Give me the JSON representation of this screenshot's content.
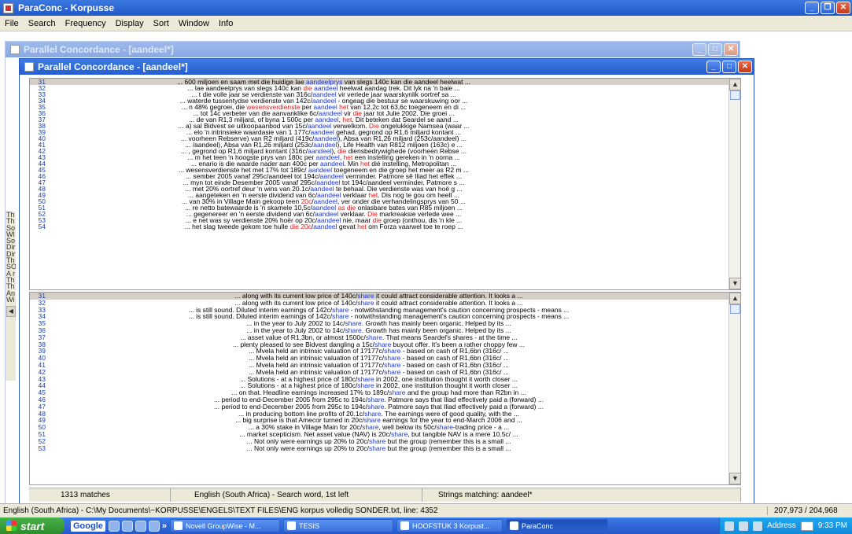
{
  "app": {
    "title": "ParaConc - Korpusse",
    "menu": [
      "File",
      "Search",
      "Frequency",
      "Display",
      "Sort",
      "Window",
      "Info"
    ]
  },
  "outer_window": {
    "title": "Parallel Concordance - [aandeel*]"
  },
  "left_strip_text": "Th\nTh\nSo\nWl\nSo\nDir\nDir\nTh\nSO\nA r\nTh\nTh\nAn\nWi",
  "inner_window": {
    "title": "Parallel Concordance - [aandeel*]"
  },
  "top_pane": {
    "rows": [
      {
        "n": "31",
        "t": "... 600 miljoen en saam met die huidige lae <b>aandeelprys</b> van slegs 140c kan die aandeel heelwat ..."
      },
      {
        "n": "32",
        "t": "... lae aandeelprys van slegs 140c kan <r>die</r> <b>aandeel</b> heelwat aandag trek. Dit lyk na 'n baie ..."
      },
      {
        "n": "33",
        "t": "... t die volle jaar se verdienste van 316c/<b>aandeel</b> vir verlede jaar waarskynlik oortref sa ..."
      },
      {
        "n": "34",
        "t": "... waterde tussentydse verdienste van 142c/<b>aandeel</b> - ongeag die bestuur se waarskuwing oor ..."
      },
      {
        "n": "35",
        "t": "... n 48% gegroei, die <r>wesensverdienste</r> per <b>aandeel</b> <r>het</r> van 12,2c tot 63,6c toegeneem en di ..."
      },
      {
        "n": "36",
        "t": "... tot 14c verbeter van die aanvanklike 6c/<b>aandeel</b> vir <r>die</r> jaar tot Julie 2002. Die groei ..."
      },
      {
        "n": "37",
        "t": "... de van R1,3 miljard, of byna 1 500c per <b>aandeel</b>, <r>het</r>. Dit beteken dat Seardel se aand ..."
      },
      {
        "n": "38",
        "t": "... a) sal Bidvest se uitkoopaanbod van 15c/<b>aandeel</b> verwelkom. <r>Die</r> ongelukkige Namsea (waar ..."
      },
      {
        "n": "39",
        "t": "... elo 'n intrinsieke waardasie van 1 177c/<b>aandeel</b> gehad, gegrond op R1,6 miljard kontant ..."
      },
      {
        "n": "40",
        "t": "... voorheen Rebserve) van R2 miljard (419c/<b>aandeel</b>), Absa van R1,26 miljard (253c/aandeel) ..."
      },
      {
        "n": "41",
        "t": "... /aandeel), Absa van R1,26 miljard (253c/<b>aandeel</b>), Life Health van R812 miljoen (163c) e ..."
      },
      {
        "n": "42",
        "t": "... , gegrond op R1,6 miljard kontant (316c/<b>aandeel</b>), <r>die</r> diensbedrywighede (voorheen Rebse ..."
      },
      {
        "n": "43",
        "t": "... m het teen 'n hoogste prys van 180c per <b>aandeel</b>, <r>het</r> een instelling gereken in 'n oorna ..."
      },
      {
        "n": "44",
        "t": "... enario is die waarde nader aan 400c per <b>aandeel</b>. Min <r>het</r> dié instelling, Metropolitan ..."
      },
      {
        "n": "45",
        "t": "... wesensverdienste het met 17% tot 189c/ <b>aandeel</b> toegeneem en die groep het meer as R2 m ..."
      },
      {
        "n": "46",
        "t": "... sember 2005 vanaf 295c/aandeel tot 194c/<b>aandeel</b> verminder. Patmore sê Iliad het effek ..."
      },
      {
        "n": "47",
        "t": "... myn tot einde Desember 2005 vanaf 295c/<b>aandeel</b> tot 194c/aandeel verminder. Patmore s ..."
      },
      {
        "n": "48",
        "t": "... met 20% oortref deur 'n wins van 20.1c/<b>aandeel</b> te behaal. Die verdienste was van hoë g ..."
      },
      {
        "n": "49",
        "t": "... aangeteken en 'n eerste dividend van 6c/<b>aandeel</b> verklaar <r>het</r>. Dis nog te gou om heelt ..."
      },
      {
        "n": "50",
        "t": "... van 30% in Village Main gekoop teen <r>20c</r>/<b>aandeel</b>, ver onder die verhandelingsprys van 50 ..."
      },
      {
        "n": "51",
        "t": "... re netto batewaarde is 'n skamele 10,5c/<b>aandeel</b> <r>as die</r> onlasbare bates van R85 miljoen ..."
      },
      {
        "n": "52",
        "t": "... gegenereer en 'n eerste dividend van 6c/<b>aandeel</b> verklaar. <r>Die</r> markreaksie verlede wee ..."
      },
      {
        "n": "53",
        "t": "... e net was sy verdienste 20% hoër op 20c/<b>aandeel</b> nie, maar <r>die</r> groep (onthou, dis 'n kle ..."
      },
      {
        "n": "54",
        "t": "... het slag tweede gekom toe hulle <r>die</r> <r>20c</r>/<b>aandeel</b> gevat <r>het</r> om Forza vaarwel toe te roep ..."
      }
    ]
  },
  "bottom_pane": {
    "rows": [
      {
        "n": "31",
        "t": "... along with its current low price of 140c/<b>share</b> it could attract considerable attention. It looks a ..."
      },
      {
        "n": "32",
        "t": "... along with its current low price of 140c/<b>share</b> it could attract considerable attention. It looks a ..."
      },
      {
        "n": "33",
        "t": "... is still sound. Diluted interim earnings of 142c/<b>share</b> - notwithstanding management's caution concerning prospects - means ..."
      },
      {
        "n": "34",
        "t": "... is still sound. Diluted interim earnings of 142c/<b>share</b> - notwithstanding management's caution concerning prospects - means ..."
      },
      {
        "n": "35",
        "t": "... in the year to July 2002 to 14c/<b>share</b>. Growth has mainly been organic. Helped by its ..."
      },
      {
        "n": "36",
        "t": "... in the year to July 2002 to 14c/<b>share</b>. Growth has mainly been organic. Helped by its ..."
      },
      {
        "n": "37",
        "t": "... asset value of R1,3bn, or almost 1500c/<b>share</b>. That means Seardel's shares - at the time ..."
      },
      {
        "n": "38",
        "t": "... plenty pleased to see Bidvest dangling a 15c/<b>share</b> buyout offer. It's been a rather choppy few ..."
      },
      {
        "n": "39",
        "t": "... Mvela held an intrinsic valuation of 1?177c/<b>share</b> - based on cash of R1,6bn (316c/ ..."
      },
      {
        "n": "40",
        "t": "... Mvela held an intrinsic valuation of 1?177c/<b>share</b> - based on cash of R1,6bn (316c/ ..."
      },
      {
        "n": "41",
        "t": "... Mvela held an intrinsic valuation of 1?177c/<b>share</b> - based on cash of R1,6bn (316c/ ..."
      },
      {
        "n": "42",
        "t": "... Mvela held an intrinsic valuation of 1?177c/<b>share</b> - based on cash of R1,6bn (316c/ ..."
      },
      {
        "n": "43",
        "t": "... Solutions - at a highest price of 180c/<b>share</b> in 2002, one institution thought it worth closer ..."
      },
      {
        "n": "44",
        "t": "... Solutions - at a highest price of 180c/<b>share</b> in 2002, one institution thought it worth closer ..."
      },
      {
        "n": "45",
        "t": "... on that. Headline earnings increased 17% to 189c/<b>share</b> and the group had more than R2bn in ..."
      },
      {
        "n": "46",
        "t": "... period to end-December 2005 from 295c to 194c/<b>share</b>. Patmore says that Iliad effectively paid a (forward) ..."
      },
      {
        "n": "47",
        "t": "... period to end-December 2005 from 295c to 194c/<b>share</b>. Patmore says that Iliad effectively paid a (forward) ..."
      },
      {
        "n": "48",
        "t": "... in producing bottom line profits of 20.1c/<b>share</b>. The earnings were of good quality, with the ..."
      },
      {
        "n": "49",
        "t": "... big surprise is that Amecor turned in 20c/<b>share</b> earnings for the year to end-March 2006 and ..."
      },
      {
        "n": "50",
        "t": "... a 30% stake in Village Main for 20c/<b>share</b>, well below its 50c/<b>share</b>-trading price - a ..."
      },
      {
        "n": "51",
        "t": "... market scepticism. Net asset value (NAV) is 20c/<b>share</b>, but tangible NAV is a mere 10.5c/ ..."
      },
      {
        "n": "52",
        "t": "... Not only were earnings up 20% to 20c/<b>share</b> but the group (remember this is a small ..."
      },
      {
        "n": "53",
        "t": "... Not only were earnings up 20% to 20c/<b>share</b> but the group (remember this is a small ..."
      }
    ]
  },
  "statusbar": {
    "matches": "1313 matches",
    "language": "English (South Africa) - Search word, 1st left",
    "strings": "Strings matching: aandeel*"
  },
  "app_status": {
    "message": "English (South Africa) - C:\\My Documents\\~KORPUSSE\\ENGELS\\TEXT FILES\\ENG korpus volledig SONDER.txt, line: 4352",
    "position": "207,973 / 204,968"
  },
  "taskbar": {
    "start": "start",
    "google": "Google",
    "more": "»",
    "tasks": [
      "Novell GroupWise - M...",
      "TESIS",
      "HOOFSTUK 3 Korpust...",
      "ParaConc"
    ],
    "address_label": "Address",
    "clock": "9:33 PM"
  }
}
